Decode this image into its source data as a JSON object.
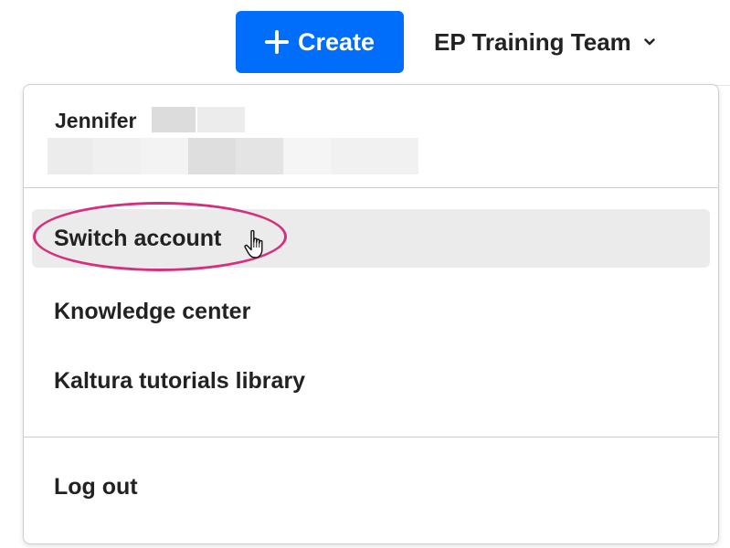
{
  "header": {
    "create_label": "Create",
    "account_name": "EP Training Team"
  },
  "menu": {
    "user_name": "Jennifer",
    "items": [
      {
        "label": "Switch account",
        "state": "hover"
      },
      {
        "label": "Knowledge center"
      },
      {
        "label": "Kaltura tutorials library"
      }
    ],
    "logout_label": "Log out"
  },
  "icons": {
    "create": "plus-icon",
    "account_toggle": "chevron-down-icon",
    "cursor": "hand-pointer-icon"
  },
  "colors": {
    "primary": "#006efa",
    "highlight": "#d62f7e",
    "hover_bg": "#ebebeb"
  }
}
